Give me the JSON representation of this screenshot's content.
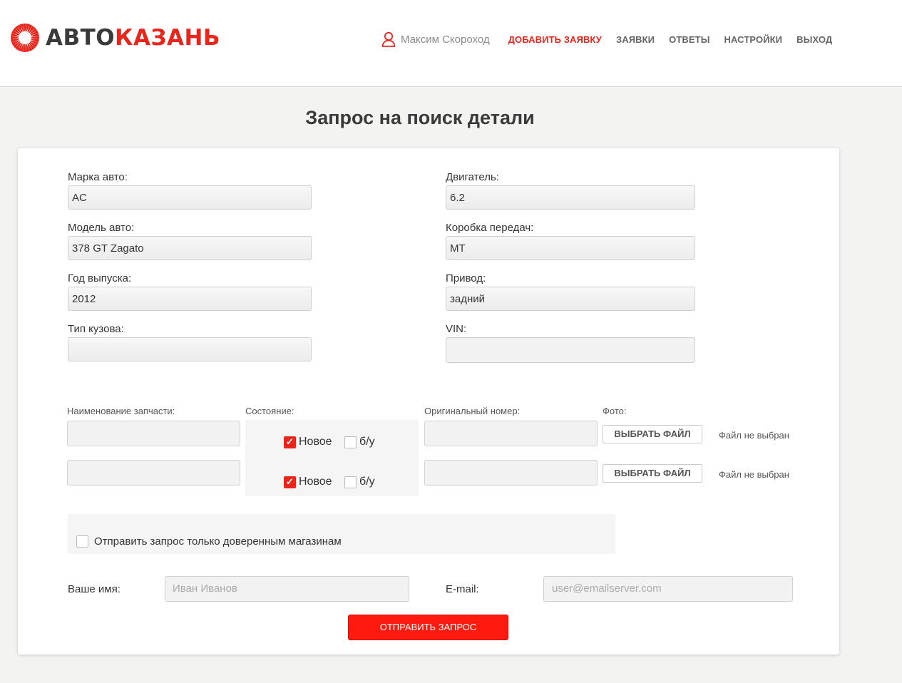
{
  "header": {
    "logo": {
      "part1": "АВТО",
      "part2": "КАЗАНЬ"
    },
    "user_name": "Максим Скороход",
    "nav": [
      {
        "label": "ДОБАВИТЬ ЗАЯВКУ",
        "active": true
      },
      {
        "label": "ЗАЯВКИ"
      },
      {
        "label": "ОТВЕТЫ"
      },
      {
        "label": "НАСТРОЙКИ"
      },
      {
        "label": "ВЫХОД"
      }
    ]
  },
  "page_title": "Запрос на поиск детали",
  "car": {
    "brand": {
      "label": "Марка авто:",
      "value": "AC"
    },
    "model": {
      "label": "Модель авто:",
      "value": "378 GT Zagato"
    },
    "year": {
      "label": "Год выпуска:",
      "value": "2012"
    },
    "body": {
      "label": "Тип кузова:",
      "value": ""
    },
    "engine": {
      "label": "Двигатель:",
      "value": "6.2"
    },
    "gearbox": {
      "label": "Коробка передач:",
      "value": "MT"
    },
    "drive": {
      "label": "Привод:",
      "value": "задний"
    },
    "vin": {
      "label": "VIN:",
      "value": ""
    }
  },
  "parts": {
    "headers": {
      "name": "Наименование запчасти:",
      "condition": "Состояние:",
      "original_number": "Оригинальный номер:",
      "photo": "Фото:"
    },
    "rows": [
      {
        "name": "",
        "new_label": "Новое",
        "new_checked": true,
        "used_label": "б/у",
        "used_checked": false,
        "number": "",
        "file_button": "ВЫБРАТЬ ФАЙЛ",
        "file_status": "Файл не выбран"
      },
      {
        "name": "",
        "new_label": "Новое",
        "new_checked": true,
        "used_label": "б/у",
        "used_checked": false,
        "number": "",
        "file_button": "ВЫБРАТЬ ФАЙЛ",
        "file_status": "Файл не выбран"
      }
    ]
  },
  "trusted_only": {
    "label": "Отправить запрос только доверенным магазинам",
    "checked": false
  },
  "contact": {
    "name_label": "Ваше имя:",
    "name_placeholder": "Иван Иванов",
    "email_label": "E-mail:",
    "email_placeholder": "user@emailserver.com"
  },
  "submit_label": "ОТПРАВИТЬ ЗАПРОС",
  "colors": {
    "accent": "#e8261c",
    "button": "#ff1a0f",
    "background": "#f3f3f1"
  }
}
